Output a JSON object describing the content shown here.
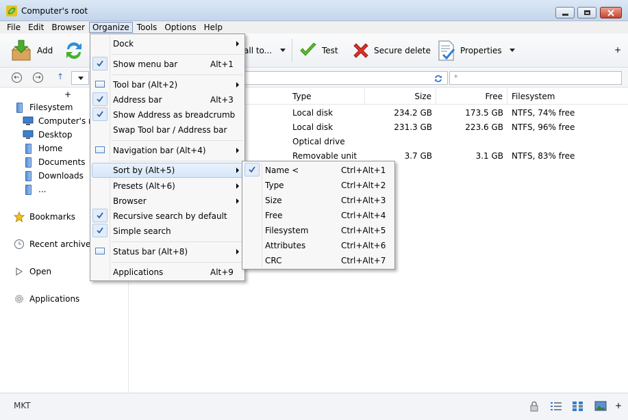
{
  "window": {
    "title": "Computer's root"
  },
  "menubar": [
    {
      "label": "File"
    },
    {
      "label": "Edit"
    },
    {
      "label": "Browser"
    },
    {
      "label": "Organize",
      "active": true
    },
    {
      "label": "Tools"
    },
    {
      "label": "Options"
    },
    {
      "label": "Help"
    }
  ],
  "toolbar": {
    "add": "Add",
    "extract_partial": "all to...",
    "test": "Test",
    "secure_delete": "Secure delete",
    "properties": "Properties",
    "more": "+"
  },
  "address": {
    "search_placeholder": "*"
  },
  "sidebar": {
    "expand": "+",
    "tree": [
      {
        "label": "Filesystem"
      },
      {
        "label": "Computer's ro"
      },
      {
        "label": "Desktop"
      },
      {
        "label": "Home"
      },
      {
        "label": "Documents"
      },
      {
        "label": "Downloads"
      },
      {
        "label": "..."
      }
    ],
    "sections": [
      {
        "label": "Bookmarks"
      },
      {
        "label": "Recent archives"
      },
      {
        "label": "Open"
      },
      {
        "label": "Applications"
      }
    ]
  },
  "filelist": {
    "columns": [
      "Type",
      "Size",
      "Free",
      "Filesystem"
    ],
    "rows": [
      {
        "type": "Local disk",
        "size": "234.2 GB",
        "free": "173.5 GB",
        "fs": "NTFS, 74% free"
      },
      {
        "type": "Local disk",
        "size": "231.3 GB",
        "free": "223.6 GB",
        "fs": "NTFS, 96% free"
      },
      {
        "type": "Optical drive",
        "size": "",
        "free": "",
        "fs": ""
      },
      {
        "type": "Removable unit",
        "size": "3.7 GB",
        "free": "3.1 GB",
        "fs": "NTFS, 83% free"
      }
    ]
  },
  "organize_menu": [
    {
      "label": "Dock",
      "submenu": true
    },
    {
      "label": "Show menu bar",
      "shortcut": "Alt+1",
      "checked": true
    },
    {
      "label": "Tool bar (Alt+2)",
      "submenu": true
    },
    {
      "label": "Address bar",
      "shortcut": "Alt+3",
      "checked": true
    },
    {
      "label": "Show Address as breadcrumb",
      "checked": true
    },
    {
      "label": "Swap Tool bar / Address bar"
    },
    {
      "label": "Navigation bar (Alt+4)",
      "submenu": true
    },
    {
      "label": "Sort by (Alt+5)",
      "submenu": true,
      "highlighted": true
    },
    {
      "label": "Presets (Alt+6)",
      "submenu": true
    },
    {
      "label": "Browser",
      "submenu": true
    },
    {
      "label": "Recursive search by default",
      "checked": true
    },
    {
      "label": "Simple search",
      "checked": true
    },
    {
      "label": "Status bar (Alt+8)",
      "submenu": true
    },
    {
      "label": "Applications",
      "shortcut": "Alt+9"
    }
  ],
  "sort_menu": [
    {
      "label": "Name <",
      "shortcut": "Ctrl+Alt+1",
      "checked": true
    },
    {
      "label": "Type",
      "shortcut": "Ctrl+Alt+2"
    },
    {
      "label": "Size",
      "shortcut": "Ctrl+Alt+3"
    },
    {
      "label": "Free",
      "shortcut": "Ctrl+Alt+4"
    },
    {
      "label": "Filesystem",
      "shortcut": "Ctrl+Alt+5"
    },
    {
      "label": "Attributes",
      "shortcut": "Ctrl+Alt+6"
    },
    {
      "label": "CRC",
      "shortcut": "Ctrl+Alt+7"
    }
  ],
  "statusbar": {
    "text": "MKT",
    "more": "+"
  },
  "colors": {
    "check": "#1f5fb8",
    "accent": "#3b78c9",
    "highlight": "#d6e6f9"
  }
}
